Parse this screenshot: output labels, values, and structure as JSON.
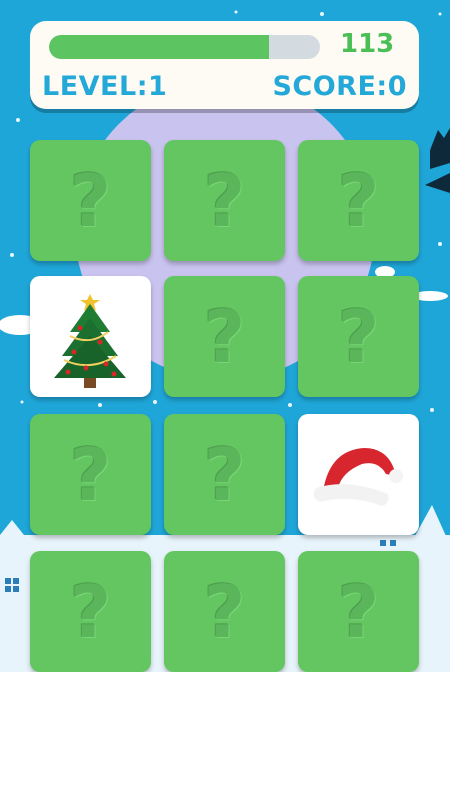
{
  "hud": {
    "timer_value": "113",
    "timer_progress": 0.81,
    "level_label": "LEVEL:1",
    "score_label": "SCORE:0"
  },
  "board": {
    "rows": 4,
    "columns": 3,
    "hidden_symbol": "?",
    "cards": [
      {
        "state": "hidden"
      },
      {
        "state": "hidden"
      },
      {
        "state": "hidden"
      },
      {
        "state": "revealed",
        "image": "christmas-tree-icon"
      },
      {
        "state": "hidden"
      },
      {
        "state": "hidden"
      },
      {
        "state": "hidden"
      },
      {
        "state": "hidden"
      },
      {
        "state": "revealed",
        "image": "santa-hat-icon"
      },
      {
        "state": "hidden"
      },
      {
        "state": "hidden"
      },
      {
        "state": "hidden"
      }
    ]
  },
  "colors": {
    "sky": "#1fa6d8",
    "card_hidden": "#63c660",
    "card_revealed": "#ffffff",
    "accent_text": "#24a8d8",
    "timer_text": "#4bbf55",
    "timer_fill": "#5cc460",
    "timer_track": "#d4dbe0"
  }
}
